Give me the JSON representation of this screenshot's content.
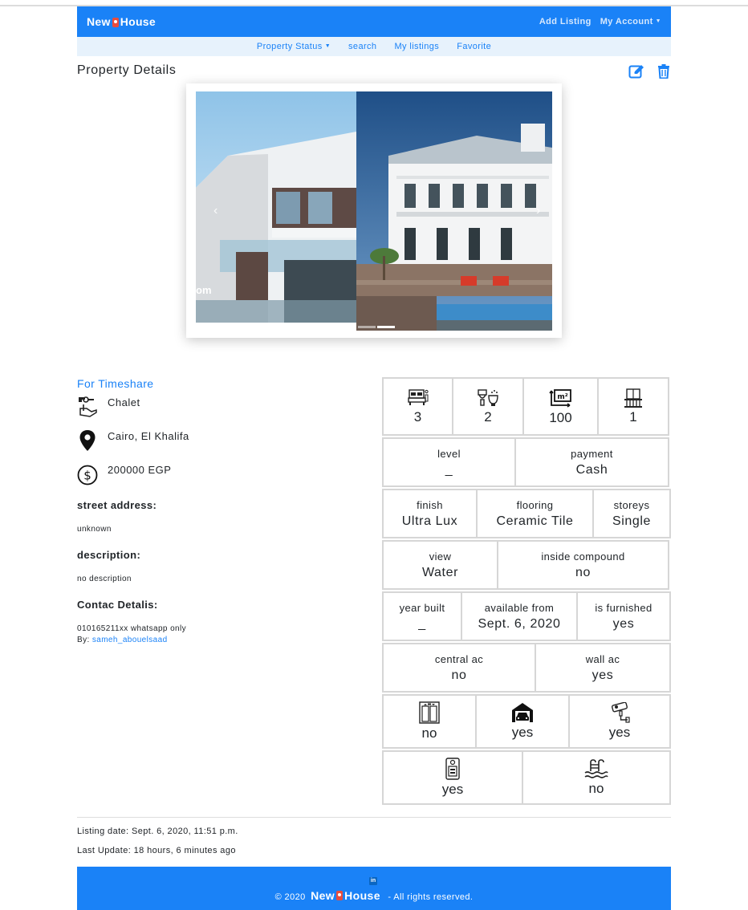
{
  "navbar": {
    "brand_left": "New",
    "brand_right": "House",
    "add_listing": "Add Listing",
    "my_account": "My Account"
  },
  "subnav": {
    "items": [
      "Property Status",
      "search",
      "My listings",
      "Favorite"
    ]
  },
  "page": {
    "title": "Property Details"
  },
  "carousel": {
    "caption_fragment": "om"
  },
  "property": {
    "status": "For Timeshare",
    "type": "Chalet",
    "location": "Cairo, El Khalifa",
    "price": "200000 EGP",
    "street_label": "street address:",
    "street_value": "unknown",
    "description_label": "description:",
    "description_value": "no description",
    "contact_label": "Contac Detalis:",
    "contact_value": "010165211xx whatsapp only",
    "by_label": "By:",
    "by_user": "sameh_abouelsaad"
  },
  "specs": {
    "bedrooms": "3",
    "bathrooms": "2",
    "area": "100",
    "balconies": "1",
    "level_label": "level",
    "level_value": "_",
    "payment_label": "payment",
    "payment_value": "Cash",
    "finish_label": "finish",
    "finish_value": "Ultra Lux",
    "flooring_label": "flooring",
    "flooring_value": "Ceramic Tile",
    "storeys_label": "storeys",
    "storeys_value": "Single",
    "view_label": "view",
    "view_value": "Water",
    "compound_label": "inside compound",
    "compound_value": "no",
    "year_label": "year built",
    "year_value": "_",
    "available_label": "available from",
    "available_value": "Sept. 6, 2020",
    "furnished_label": "is furnished",
    "furnished_value": "yes",
    "central_ac_label": "central ac",
    "central_ac_value": "no",
    "wall_ac_label": "wall ac",
    "wall_ac_value": "yes",
    "elevator_value": "no",
    "garage_value": "yes",
    "security_value": "yes",
    "intercom_value": "yes",
    "pool_value": "no",
    "area_icon_text": "m²"
  },
  "meta": {
    "listing_date": "Listing date: Sept. 6, 2020, 11:51 p.m.",
    "last_update": "Last Update: 18 hours, 6 minutes ago"
  },
  "footer": {
    "linkedin_glyph": "in",
    "copyright": "© 2020",
    "brand_left": "New",
    "brand_right": "House",
    "rights": "- All rights reserved."
  },
  "colors": {
    "primary": "#1a82f7",
    "subnav_bg": "#e7f2fc",
    "border": "#d6d6d6"
  }
}
